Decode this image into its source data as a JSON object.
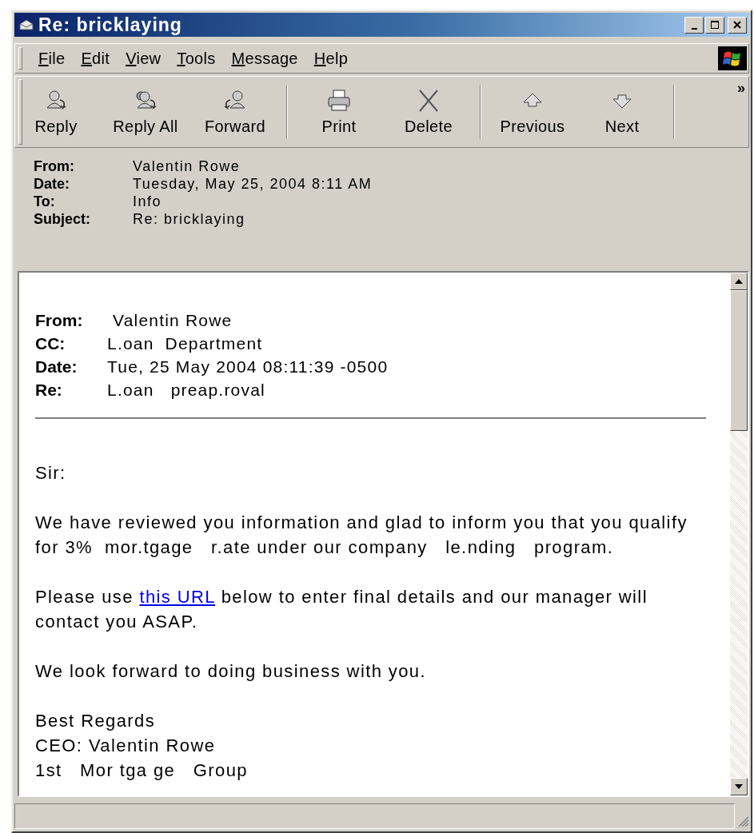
{
  "window": {
    "title": "Re: bricklaying"
  },
  "menu": [
    {
      "label": "File"
    },
    {
      "label": "Edit"
    },
    {
      "label": "View"
    },
    {
      "label": "Tools"
    },
    {
      "label": "Message"
    },
    {
      "label": "Help"
    }
  ],
  "toolbar": [
    {
      "kind": "button",
      "label": "Reply"
    },
    {
      "kind": "button",
      "label": "Reply All"
    },
    {
      "kind": "button",
      "label": "Forward"
    },
    {
      "kind": "separator"
    },
    {
      "kind": "button",
      "label": "Print"
    },
    {
      "kind": "button",
      "label": "Delete"
    },
    {
      "kind": "separator"
    },
    {
      "kind": "button",
      "label": "Previous"
    },
    {
      "kind": "button",
      "label": "Next"
    },
    {
      "kind": "separator"
    },
    {
      "kind": "overflow",
      "label": "»"
    }
  ],
  "header": [
    {
      "label": "From:",
      "value": "Valentin Rowe"
    },
    {
      "label": "Date:",
      "value": "Tuesday, May 25, 2004 8:11 AM"
    },
    {
      "label": "To:",
      "value": "Info"
    },
    {
      "label": "Subject:",
      "value": "Re: bricklaying"
    }
  ],
  "message": {
    "header": [
      {
        "label": "From:",
        "value": " Valentin Rowe"
      },
      {
        "label": "CC:",
        "value": "L.oan  Department"
      },
      {
        "label": "Date:",
        "value": "Tue, 25 May 2004 08:11:39 -0500"
      },
      {
        "label": "Re:",
        "value": "L.oan   preap.roval"
      }
    ],
    "paragraphs": [
      {
        "segments": [
          {
            "kind": "text",
            "text": "Sir:"
          }
        ]
      },
      {
        "segments": [
          {
            "kind": "text",
            "text": "We have reviewed you information and glad to inform you that you qualify\nfor 3%  mor.tgage   r.ate under our company   le.nding   program."
          }
        ]
      },
      {
        "segments": [
          {
            "kind": "text",
            "text": "Please use "
          },
          {
            "kind": "link",
            "text": "this URL"
          },
          {
            "kind": "text",
            "text": " below to enter final details and our manager will\ncontact you ASAP."
          }
        ]
      },
      {
        "segments": [
          {
            "kind": "text",
            "text": "We look forward to doing business with you."
          }
        ]
      },
      {
        "segments": [
          {
            "kind": "text",
            "text": "Best Regards\nCEO: Valentin Rowe\n1st   Mor tga ge   Group"
          }
        ]
      }
    ]
  }
}
